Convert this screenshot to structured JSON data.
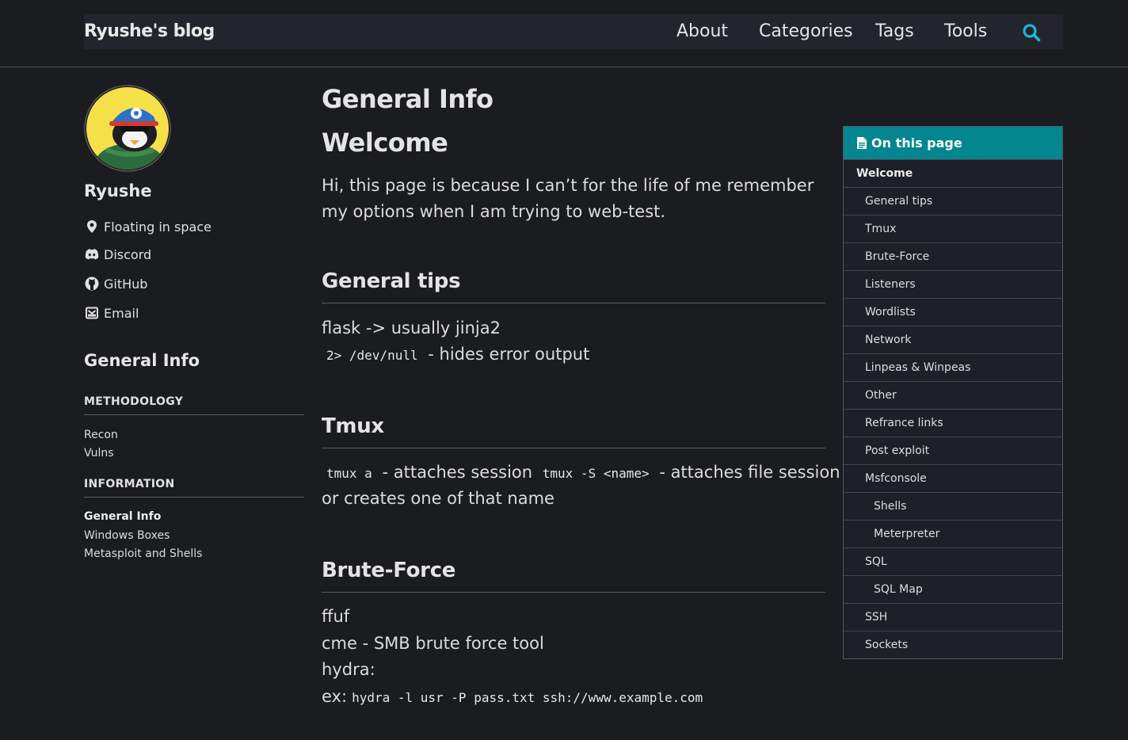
{
  "header": {
    "brand": "Ryushe's blog",
    "nav": [
      "About",
      "Categories",
      "Tags",
      "Tools"
    ],
    "search_icon": "search-icon",
    "search_color": "#1bb8d8"
  },
  "sidebar": {
    "author": "Ryushe",
    "links": [
      {
        "icon": "location-icon",
        "label": "Floating in space"
      },
      {
        "icon": "discord-icon",
        "label": "Discord"
      },
      {
        "icon": "github-icon",
        "label": "GitHub"
      },
      {
        "icon": "email-icon",
        "label": "Email"
      }
    ],
    "page_heading": "General Info",
    "sections": [
      {
        "title": "METHODOLOGY",
        "items": [
          "Recon",
          "Vulns"
        ]
      },
      {
        "title": "INFORMATION",
        "items": [
          "General Info",
          "Windows Boxes",
          "Metasploit and Shells"
        ]
      }
    ]
  },
  "main": {
    "title": "General Info",
    "welcome_heading": "Welcome",
    "intro": "Hi, this page is because I can’t for the life of me remember my options when I am trying to web-test.",
    "general_tips": {
      "heading": "General tips",
      "line1": "flask -> usually jinja2",
      "code1": "2> /dev/null",
      "line2_text": "- hides error output"
    },
    "tmux": {
      "heading": "Tmux",
      "code1": "tmux a",
      "text1": "- attaches session",
      "code2": "tmux -S <name>",
      "text2": "- attaches file session",
      "text3": "or creates one of that name"
    },
    "brute_force": {
      "heading": "Brute-Force",
      "line1": "ffuf",
      "line2": "cme - SMB brute force tool",
      "line3": "hydra:",
      "ex_label": "ex:",
      "ex_code": "hydra -l usr -P pass.txt ssh://www.example.com"
    }
  },
  "toc": {
    "header": "On this page",
    "accent": "#03868f",
    "items": [
      "Welcome",
      "General tips",
      "Tmux",
      "Brute-Force",
      "Listeners",
      "Wordlists",
      "Network",
      "Linpeas & Winpeas",
      "Other",
      "Refrance links",
      "Post exploit",
      "Msfconsole",
      "Shells",
      "Meterpreter",
      "SQL",
      "SQL Map",
      "SSH",
      "Sockets"
    ]
  }
}
